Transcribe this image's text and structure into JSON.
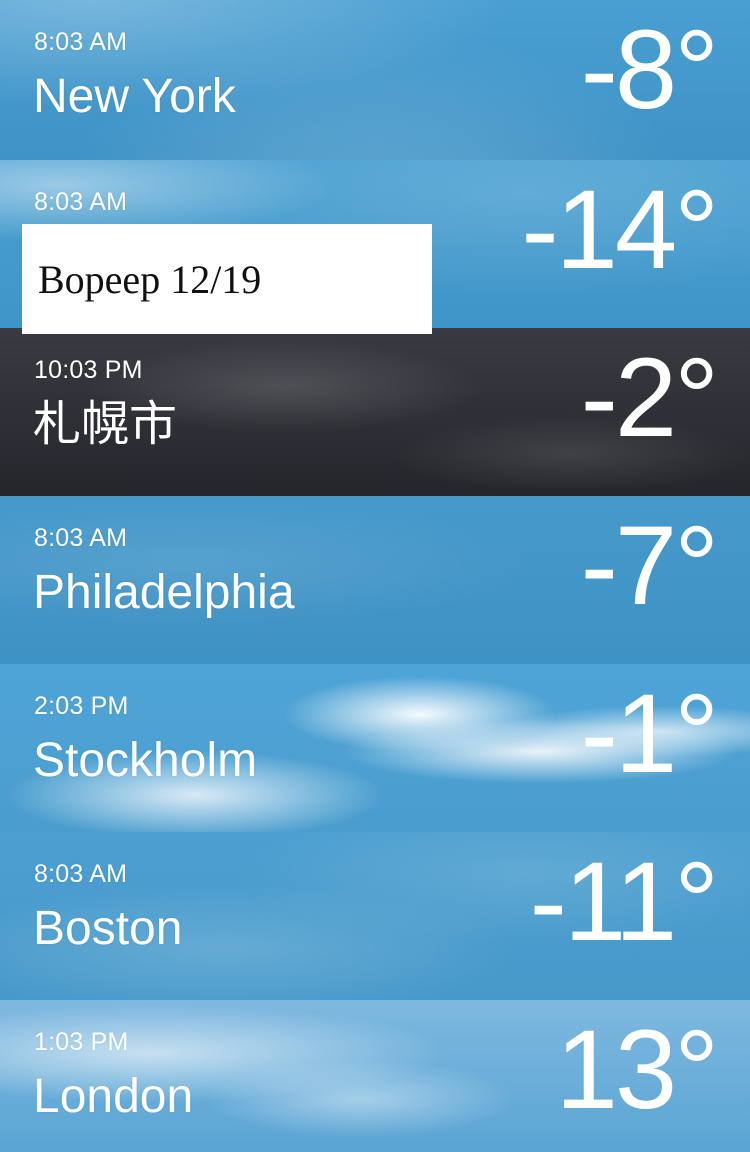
{
  "cities": [
    {
      "time": "8:03 AM",
      "name": "New York",
      "temp": "-8°"
    },
    {
      "time": "8:03 AM",
      "name": "",
      "temp": "-14°"
    },
    {
      "time": "10:03 PM",
      "name": "札幌市",
      "temp": "-2°"
    },
    {
      "time": "8:03 AM",
      "name": "Philadelphia",
      "temp": "-7°"
    },
    {
      "time": "2:03 PM",
      "name": "Stockholm",
      "temp": "-1°"
    },
    {
      "time": "8:03 AM",
      "name": "Boston",
      "temp": "-11°"
    },
    {
      "time": "1:03 PM",
      "name": "London",
      "temp": "13°"
    }
  ],
  "overlay_label": "Bopeep 12/19",
  "colors": {
    "sky_blue": "#3f97c6",
    "night_slate": "#2f3037",
    "cloud_white": "#f3f7fb"
  }
}
